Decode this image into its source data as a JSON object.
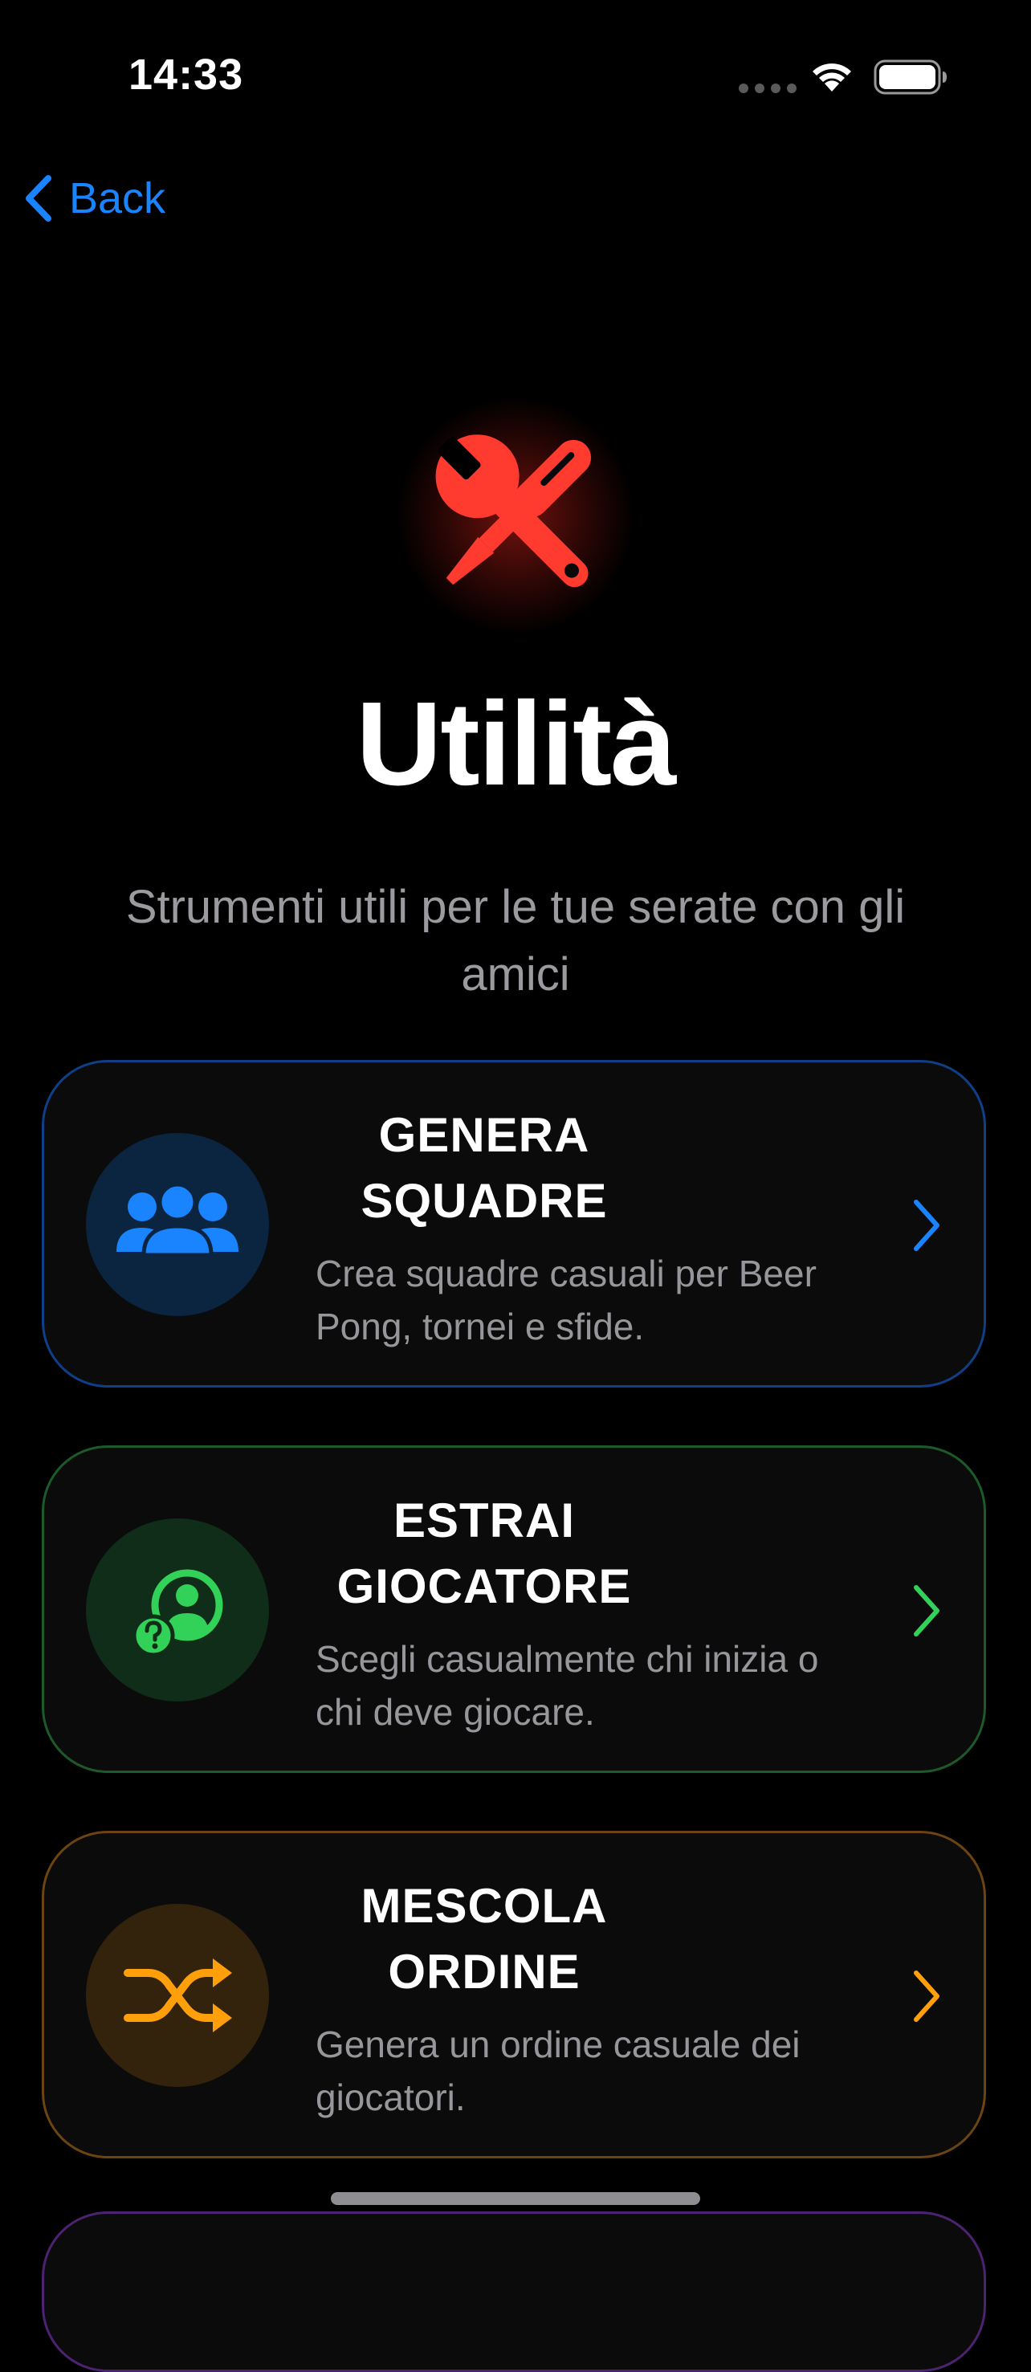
{
  "status_bar": {
    "time": "14:33"
  },
  "nav": {
    "back_label": "Back"
  },
  "header": {
    "title": "Utilità",
    "subtitle": "Strumenti utili per le tue serate con gli amici",
    "icon": "tools-icon",
    "icon_color": "#ff3b30"
  },
  "cards": [
    {
      "title": "GENERA SQUADRE",
      "description": "Crea squadre casuali per Beer Pong, tornei e sfide.",
      "icon": "group-icon",
      "accent": "#1a84ff"
    },
    {
      "title": "ESTRAI GIOCATORE",
      "description": "Scegli casualmente chi inizia o chi deve giocare.",
      "icon": "random-player-icon",
      "accent": "#32d158"
    },
    {
      "title": "MESCOLA ORDINE",
      "description": "Genera un ordine casuale dei giocatori.",
      "icon": "shuffle-icon",
      "accent": "#ff9f0a"
    }
  ]
}
